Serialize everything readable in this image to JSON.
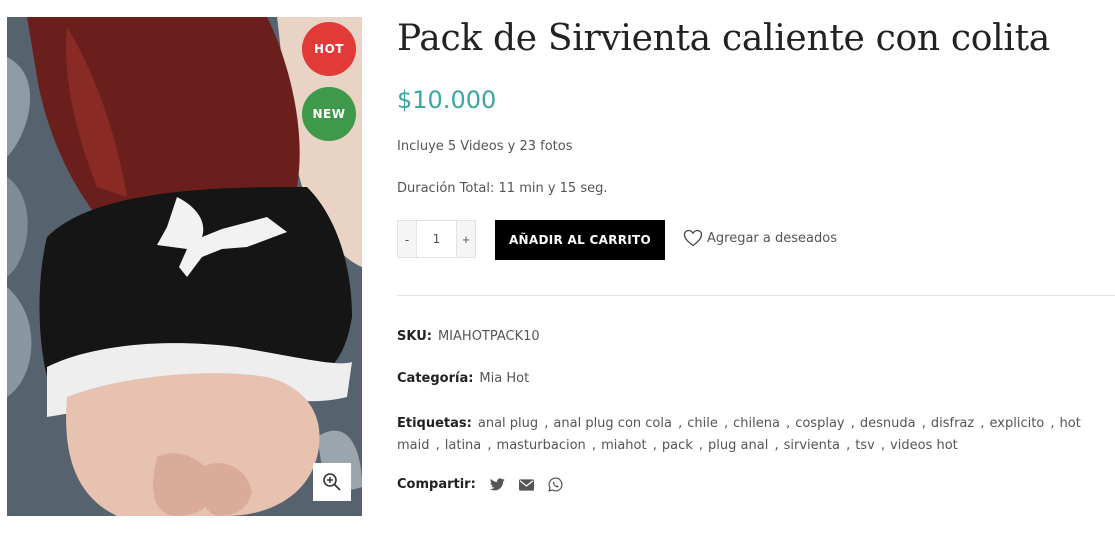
{
  "badges": {
    "hot": "HOT",
    "new": "NEW"
  },
  "product": {
    "title": "Pack de Sirvienta caliente con colita",
    "price": "$10.000",
    "description_line1": "Incluye 5 Videos y 23 fotos",
    "description_line2": "Duración Total: 11 min y 15 seg."
  },
  "cart": {
    "minus_label": "-",
    "plus_label": "+",
    "quantity": "1",
    "add_to_cart_label": "AÑADIR AL CARRITO",
    "wishlist_label": "Agregar a deseados"
  },
  "meta": {
    "sku_label": "SKU:",
    "sku_value": "MIAHOTPACK10",
    "category_label": "Categoría:",
    "category_value": "Mia Hot",
    "tags_label": "Etiquetas:",
    "tags": [
      "anal plug",
      "anal plug con cola",
      "chile",
      "chilena",
      "cosplay",
      "desnuda",
      "disfraz",
      "explicito",
      "hot maid",
      "latina",
      "masturbacion",
      "miahot",
      "pack",
      "plug anal",
      "sirvienta",
      "tsv",
      "videos hot"
    ],
    "share_label": "Compartir:",
    "share_icons": [
      "twitter-icon",
      "email-icon",
      "whatsapp-icon"
    ]
  },
  "colors": {
    "price": "#3aa89f",
    "hot_badge": "#e23a37",
    "new_badge": "#3e9a4a",
    "button": "#000000"
  }
}
